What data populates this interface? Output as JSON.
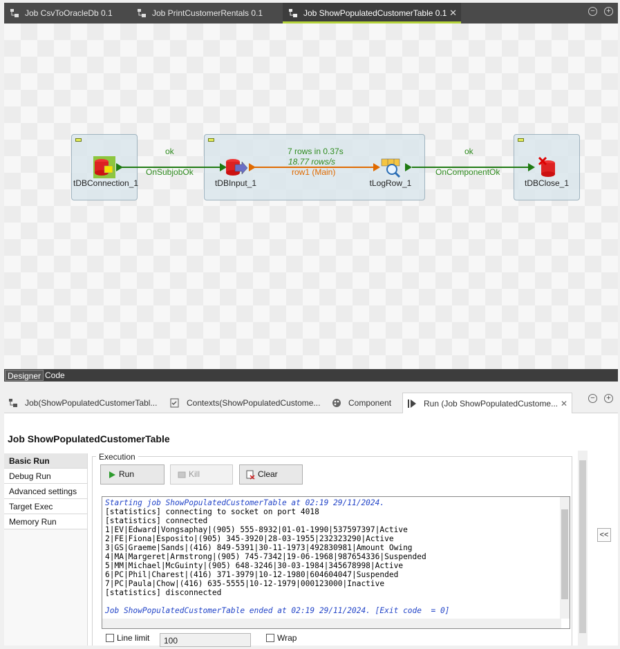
{
  "editor_tabs": [
    {
      "label": "Job CsvToOracleDb 0.1",
      "active": false
    },
    {
      "label": "Job PrintCustomerRentals 0.1",
      "active": false
    },
    {
      "label": "Job ShowPopulatedCustomerTable 0.1",
      "active": true
    }
  ],
  "editor_close": "✕",
  "window_controls": {
    "minimize": "−",
    "maximize": "+"
  },
  "components": {
    "dbconnection": "tDBConnection_1",
    "dbinput": "tDBInput_1",
    "logrow": "tLogRow_1",
    "dbclose": "tDBClose_1"
  },
  "links": {
    "subjob_ok_label": "ok",
    "subjob_ok_name": "OnSubjobOk",
    "row_stats_count": "7 rows in 0.37s",
    "row_stats_rate": "18.77 rows/s",
    "row_name": "row1 (Main)",
    "comp_ok_label": "ok",
    "comp_ok_name": "OnComponentOk"
  },
  "view_tabs": [
    "Designer",
    "Code"
  ],
  "panel_tabs": [
    {
      "label": "Job(ShowPopulatedCustomerTabl...",
      "icon": "job-icon"
    },
    {
      "label": "Contexts(ShowPopulatedCustome...",
      "icon": "contexts-icon"
    },
    {
      "label": "Component",
      "icon": "component-icon"
    },
    {
      "label": "Run (Job ShowPopulatedCustome...",
      "icon": "run-icon",
      "active": true
    }
  ],
  "run": {
    "title": "Job ShowPopulatedCustomerTable",
    "side_items": [
      "Basic Run",
      "Debug Run",
      "Advanced settings",
      "Target Exec",
      "Memory Run"
    ],
    "execution_legend": "Execution",
    "buttons": {
      "run": "Run",
      "kill": "Kill",
      "clear": "Clear"
    },
    "console": [
      {
        "text": "Starting job ShowPopulatedCustomerTable at 02:19 29/11/2024.",
        "italic": true
      },
      {
        "text": "[statistics] connecting to socket on port 4018"
      },
      {
        "text": "[statistics] connected"
      },
      {
        "text": "1|EV|Edward|Vongsaphay|(905) 555-8932|01-01-1990|537597397|Active"
      },
      {
        "text": "2|FE|Fiona|Esposito|(905) 345-3920|28-03-1955|232323290|Active"
      },
      {
        "text": "3|GS|Graeme|Sands|(416) 849-5391|30-11-1973|492830981|Amount Owing"
      },
      {
        "text": "4|MA|Margeret|Armstrong|(905) 745-7342|19-06-1968|987654336|Suspended"
      },
      {
        "text": "5|MM|Michael|McGuinty|(905) 648-3246|30-03-1984|345678998|Active"
      },
      {
        "text": "6|PC|Phil|Charest|(416) 371-3979|10-12-1980|604604047|Suspended"
      },
      {
        "text": "7|PC|Paula|Chow|(416) 635-5555|10-12-1979|000123000|Inactive"
      },
      {
        "text": "[statistics] disconnected"
      },
      {
        "text": ""
      },
      {
        "text": "Job ShowPopulatedCustomerTable ended at 02:19 29/11/2024. [Exit code  = 0]",
        "italic": true
      }
    ],
    "line_limit_label": "Line limit",
    "line_limit_value": "100",
    "wrap_label": "Wrap",
    "collapse": "<<"
  }
}
